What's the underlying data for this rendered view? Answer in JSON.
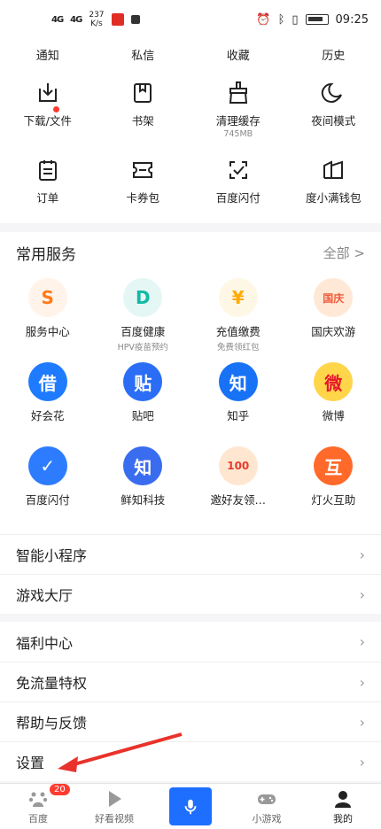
{
  "status": {
    "signal1": "4G",
    "signal2": "4G",
    "speed": "237\nK/s",
    "time": "09:25"
  },
  "quick": [
    "通知",
    "私信",
    "收藏",
    "历史"
  ],
  "tools": [
    {
      "label": "下载/文件",
      "sub": "",
      "icon": "download-icon"
    },
    {
      "label": "书架",
      "sub": "",
      "icon": "bookshelf-icon"
    },
    {
      "label": "清理缓存",
      "sub": "745MB",
      "icon": "clean-brush-icon"
    },
    {
      "label": "夜间模式",
      "sub": "",
      "icon": "night-moon-icon"
    },
    {
      "label": "订单",
      "sub": "",
      "icon": "order-icon"
    },
    {
      "label": "卡券包",
      "sub": "",
      "icon": "coupon-icon"
    },
    {
      "label": "百度闪付",
      "sub": "",
      "icon": "flash-pay-icon"
    },
    {
      "label": "度小满钱包",
      "sub": "",
      "icon": "wallet-icon"
    }
  ],
  "services": {
    "title": "常用服务",
    "more": "全部 >",
    "items": [
      {
        "label": "服务中心",
        "sub": "",
        "glyph": "S",
        "color": "#ff7a1a",
        "bg": "#fff3ea"
      },
      {
        "label": "百度健康",
        "sub": "HPV疫苗预约",
        "glyph": "D",
        "color": "#13b9a6",
        "bg": "#e5f7f5"
      },
      {
        "label": "充值缴费",
        "sub": "免费领红包",
        "glyph": "¥",
        "color": "#ffaa00",
        "bg": "#fff7e6"
      },
      {
        "label": "国庆欢游",
        "sub": "",
        "glyph": "国庆",
        "color": "#f25a3a",
        "bg": "#ffe8d6"
      },
      {
        "label": "好会花",
        "sub": "",
        "glyph": "借",
        "color": "#1e7bff",
        "bg": "#1e7bff"
      },
      {
        "label": "贴吧",
        "sub": "",
        "glyph": "贴",
        "color": "#2b6ef5",
        "bg": "#2b6ef5"
      },
      {
        "label": "知乎",
        "sub": "",
        "glyph": "知",
        "color": "#1772f6",
        "bg": "#1772f6"
      },
      {
        "label": "微博",
        "sub": "",
        "glyph": "微",
        "color": "#e6162d",
        "bg": "#ffd54a"
      },
      {
        "label": "百度闪付",
        "sub": "",
        "glyph": "✓",
        "color": "#2d7cff",
        "bg": "#2d7cff"
      },
      {
        "label": "鲜知科技",
        "sub": "",
        "glyph": "知",
        "color": "#3a6cf0",
        "bg": "#3a6cf0"
      },
      {
        "label": "邀好友领…",
        "sub": "",
        "glyph": "100",
        "color": "#e83b2e",
        "bg": "#ffe6d0"
      },
      {
        "label": "灯火互助",
        "sub": "",
        "glyph": "互",
        "color": "#ff6a2a",
        "bg": "#ff6a2a"
      }
    ]
  },
  "list1": [
    "智能小程序",
    "游戏大厅"
  ],
  "list2": [
    "福利中心",
    "免流量特权",
    "帮助与反馈",
    "设置"
  ],
  "nav": [
    {
      "label": "百度",
      "badge": "20"
    },
    {
      "label": "好看视频",
      "badge": ""
    },
    {
      "label": "",
      "badge": ""
    },
    {
      "label": "小游戏",
      "badge": ""
    },
    {
      "label": "我的",
      "badge": ""
    }
  ],
  "chevron": "›"
}
